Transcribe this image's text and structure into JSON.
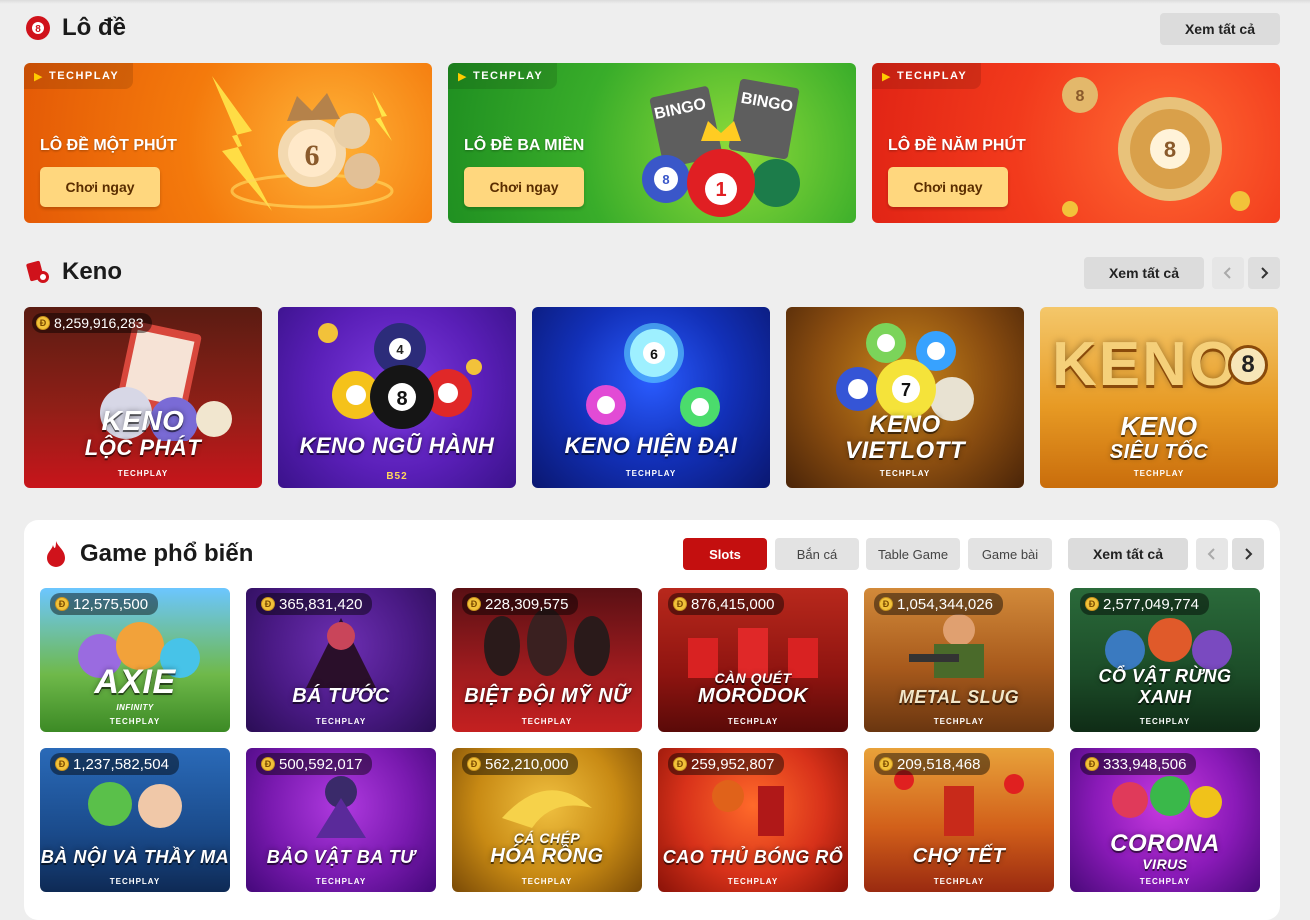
{
  "lode": {
    "title": "Lô đề",
    "see_all": "Xem tất cả",
    "brand": "TECHPLAY",
    "cards": [
      {
        "name": "LÔ ĐỀ MỘT PHÚT",
        "button": "Chơi ngay"
      },
      {
        "name": "LÔ ĐỀ BA MIỀN",
        "button": "Chơi ngay"
      },
      {
        "name": "LÔ ĐỀ NĂM PHÚT",
        "button": "Chơi ngay"
      }
    ]
  },
  "keno": {
    "title": "Keno",
    "see_all": "Xem tất cả",
    "cards": [
      {
        "jackpot": "8,259,916,283",
        "title_line1": "KENO",
        "title_line2": "LỘC PHÁT",
        "brand": "TECHPLAY"
      },
      {
        "title_line1": "KENO NGŨ HÀNH",
        "brand": "B52"
      },
      {
        "title_line1": "KENO HIỆN ĐẠI",
        "brand": "TECHPLAY"
      },
      {
        "title_line1": "KENO",
        "title_line2": "VIETLOTT",
        "brand": "TECHPLAY"
      },
      {
        "title_line1": "KENO",
        "title_line2": "SIÊU TỐC",
        "brand": "TECHPLAY",
        "logo_text": "KENO",
        "logo_num": "8"
      }
    ]
  },
  "popular": {
    "title": "Game phổ biến",
    "see_all": "Xem tất cả",
    "filters": [
      "Slots",
      "Bắn cá",
      "Table Game",
      "Game bài"
    ],
    "brand": "TECHPLAY",
    "games": [
      {
        "jackpot": "12,575,500",
        "title": "AXIE",
        "sub": "INFINITY"
      },
      {
        "jackpot": "365,831,420",
        "title": "BÁ TƯỚC"
      },
      {
        "jackpot": "228,309,575",
        "title": "BIỆT ĐỘI MỸ NỮ"
      },
      {
        "jackpot": "876,415,000",
        "title": "MORODOK",
        "pre": "CÀN QUÉT"
      },
      {
        "jackpot": "1,054,344,026",
        "title": "METAL SLUG"
      },
      {
        "jackpot": "2,577,049,774",
        "title": "CỔ VẬT RỪNG XANH"
      },
      {
        "jackpot": "1,237,582,504",
        "title": "BÀ NỘI VÀ THẦY MA"
      },
      {
        "jackpot": "500,592,017",
        "title": "BẢO VẬT BA TƯ"
      },
      {
        "jackpot": "562,210,000",
        "title": "HÓA RỒNG",
        "pre": "CÁ CHÉP"
      },
      {
        "jackpot": "259,952,807",
        "title": "CAO THỦ BÓNG RỔ"
      },
      {
        "jackpot": "209,518,468",
        "title": "CHỢ TẾT"
      },
      {
        "jackpot": "333,948,506",
        "title": "CORONA",
        "sub": "VIRUS"
      }
    ]
  },
  "colors": {
    "accent": "#c40f0f",
    "cta": "#ffd77e"
  }
}
